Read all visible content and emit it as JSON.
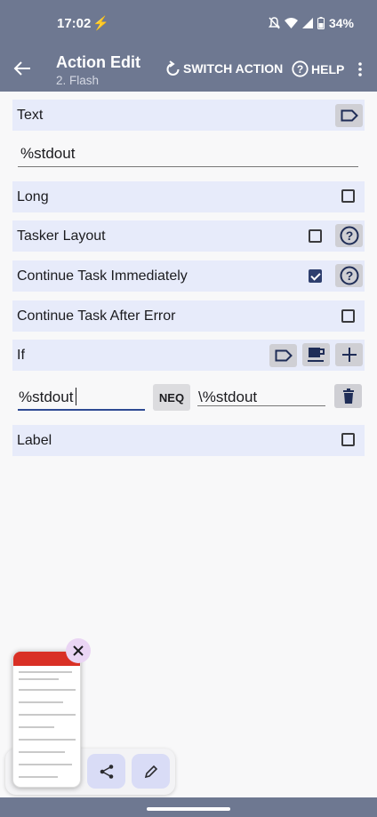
{
  "status_bar": {
    "time": "17:02",
    "battery": "34%"
  },
  "app_bar": {
    "title": "Action Edit",
    "subtitle": "2. Flash",
    "switch_action_label": "SWITCH ACTION",
    "help_label": "HELP"
  },
  "fields": {
    "text_label": "Text",
    "text_value": "%stdout",
    "long_label": "Long",
    "tasker_layout_label": "Tasker Layout",
    "continue_immediately_label": "Continue Task Immediately",
    "continue_after_error_label": "Continue Task After Error",
    "if_label": "If",
    "if_left_value": "%stdout",
    "if_operator": "NEQ",
    "if_right_value": "\\%stdout",
    "label_label": "Label"
  },
  "checkboxes": {
    "long": false,
    "tasker_layout": false,
    "continue_immediately": true,
    "continue_after_error": false,
    "label": false
  },
  "colors": {
    "app_bar": "#6e7891",
    "row_background": "#e7ebfa",
    "accent": "#2e3f6e"
  }
}
